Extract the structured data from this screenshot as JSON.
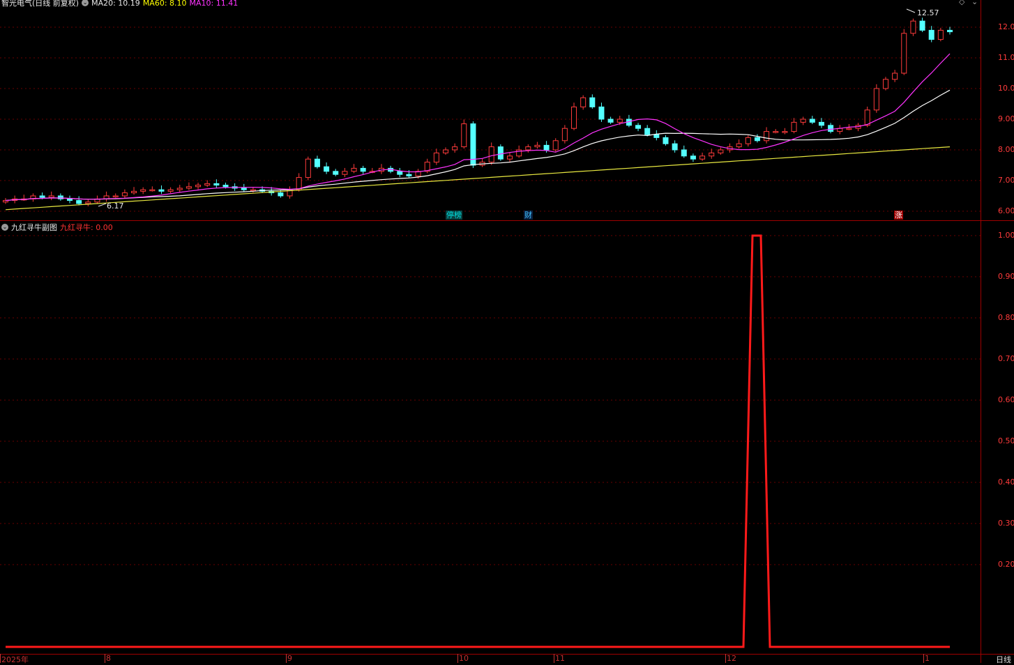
{
  "main_chart": {
    "stock_name": "智光电气(日线 前复权)",
    "ma20_label": "MA20: 10.19",
    "ma60_label": "MA60: 8.10",
    "ma10_label": "MA10: 11.41",
    "high_label": "12.57",
    "low_label": "6.17",
    "price_axis": [
      "12.00",
      "11.00",
      "10.00",
      "9.00",
      "8.00",
      "7.00",
      "6.00"
    ],
    "badges": [
      {
        "text": "停榜",
        "color": "#00c0c0",
        "bg": "#004040"
      },
      {
        "text": "财",
        "color": "#00c0ff",
        "bg": "#002040"
      },
      {
        "text": "涨",
        "color": "#ffffff",
        "bg": "#a00000"
      }
    ],
    "colors": {
      "up": "#ff3b3b",
      "down": "#54ffff",
      "ma10": "#ff33ff",
      "ma20": "#ffffff",
      "ma60": "#e8e840"
    }
  },
  "sub_chart": {
    "title": "九红寻牛副图",
    "indicator_label": "九红寻牛: 0.00",
    "value_axis": [
      "1.00",
      "0.90",
      "0.80",
      "0.70",
      "0.60",
      "0.50",
      "0.40",
      "0.30",
      "0.20"
    ],
    "line_color": "#ff1a1a"
  },
  "date_axis": {
    "labels": [
      "2025年",
      "8",
      "9",
      "10",
      "11",
      "12",
      "1"
    ],
    "period": "日线"
  },
  "chart_data": [
    {
      "type": "candlestick",
      "title": "智光电气(日线 前复权)",
      "ylim": [
        5.8,
        12.8
      ],
      "series": [
        {
          "name": "MA20",
          "value": 10.19
        },
        {
          "name": "MA60",
          "value": 8.1
        },
        {
          "name": "MA10",
          "value": 11.41
        }
      ],
      "annotations": {
        "high": 12.57,
        "low": 6.17
      },
      "close_estimates": [
        6.35,
        6.4,
        6.4,
        6.5,
        6.45,
        6.5,
        6.4,
        6.35,
        6.25,
        6.3,
        6.4,
        6.5,
        6.5,
        6.6,
        6.65,
        6.7,
        6.7,
        6.65,
        6.7,
        6.75,
        6.8,
        6.85,
        6.9,
        6.85,
        6.8,
        6.75,
        6.7,
        6.7,
        6.65,
        6.6,
        6.5,
        6.7,
        7.1,
        7.7,
        7.45,
        7.3,
        7.2,
        7.3,
        7.4,
        7.3,
        7.3,
        7.4,
        7.3,
        7.2,
        7.15,
        7.3,
        7.6,
        7.9,
        8.0,
        8.1,
        8.85,
        7.5,
        7.6,
        8.1,
        7.7,
        7.8,
        8.0,
        8.1,
        8.15,
        8.0,
        8.3,
        8.7,
        9.4,
        9.7,
        9.4,
        9.0,
        8.9,
        9.0,
        8.8,
        8.7,
        8.5,
        8.4,
        8.2,
        8.0,
        7.8,
        7.7,
        7.8,
        7.9,
        8.0,
        8.1,
        8.2,
        8.4,
        8.3,
        8.6,
        8.6,
        8.6,
        8.9,
        9.0,
        8.9,
        8.8,
        8.6,
        8.7,
        8.7,
        8.8,
        9.3,
        10.0,
        10.3,
        10.5,
        11.8,
        12.2,
        11.9,
        11.6,
        11.9,
        11.85
      ]
    },
    {
      "type": "line",
      "title": "九红寻牛副图",
      "series": [
        {
          "name": "九红寻牛",
          "current": 0.0
        }
      ],
      "ylim": [
        0,
        1.0
      ],
      "pulse": {
        "value": 1.0,
        "period_label": "12"
      }
    }
  ]
}
